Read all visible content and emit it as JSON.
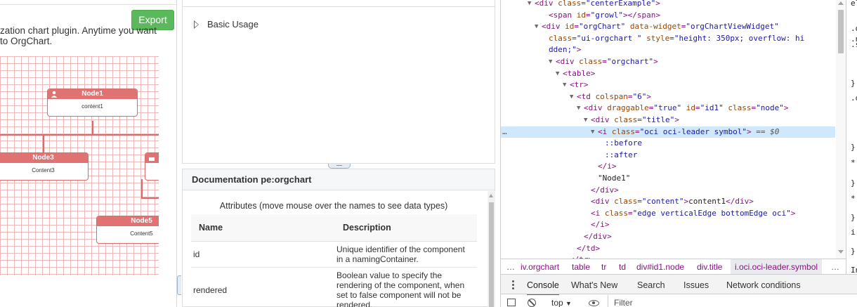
{
  "left": {
    "export_label": "Export",
    "intro_line1": "zation chart plugin. Anytime you want",
    "intro_line2": "to OrgChart.",
    "nodes": [
      {
        "title": "Node1",
        "content": "content1"
      },
      {
        "title": "Node3",
        "content": "Content3"
      },
      {
        "title": "Node5",
        "content": "Content5"
      }
    ]
  },
  "middle": {
    "basic_usage": "Basic Usage",
    "doc_title": "Documentation pe:orgchart",
    "attributes_caption": "Attributes (move mouse over the names to see data types)",
    "columns": [
      "Name",
      "Description"
    ],
    "rows": [
      {
        "name": "id",
        "desc": "Unique identifier of the component in a namingContainer."
      },
      {
        "name": "rendered",
        "desc": "Boolean value to specify the rendering of the component, when set to false component will not be rendered."
      }
    ]
  },
  "devtools": {
    "lines": [
      {
        "indent": 5,
        "arrow": "▼",
        "html": "<span class='tag'>&lt;div</span> <span class='an'>class</span><span class='tag'>=</span><span class='av'>\"centerExample\"</span><span class='tag'>&gt;</span>"
      },
      {
        "indent": 7,
        "arrow": "",
        "html": "<span class='tag'>&lt;span</span> <span class='an'>id</span><span class='tag'>=</span><span class='av'>\"growl\"</span><span class='tag'>&gt;&lt;/span&gt;</span>"
      },
      {
        "indent": 6,
        "arrow": "▼",
        "html": "<span class='tag'>&lt;div</span> <span class='an'>id</span><span class='tag'>=</span><span class='av'>\"orgChart\"</span> <span class='an'>data-widget</span><span class='tag'>=</span><span class='av'>\"orgChartViewWidget\"</span>"
      },
      {
        "indent": 7,
        "arrow": "",
        "html": "<span class='an'>class</span><span class='tag'>=</span><span class='av'>\"ui-orgchart \"</span> <span class='an'>style</span><span class='tag'>=</span><span class='av'>\"height: 350px; overflow: hi</span>"
      },
      {
        "indent": 7,
        "arrow": "",
        "html": "<span class='av'>dden;\"</span><span class='tag'>&gt;</span>"
      },
      {
        "indent": 8,
        "arrow": "▼",
        "html": "<span class='tag'>&lt;div</span> <span class='an'>class</span><span class='tag'>=</span><span class='av'>\"orgchart\"</span><span class='tag'>&gt;</span>"
      },
      {
        "indent": 9,
        "arrow": "▼",
        "html": "<span class='tag'>&lt;table&gt;</span>"
      },
      {
        "indent": 10,
        "arrow": "▼",
        "html": "<span class='tag'>&lt;tr&gt;</span>"
      },
      {
        "indent": 11,
        "arrow": "▼",
        "html": "<span class='tag'>&lt;td</span> <span class='an'>colspan</span><span class='tag'>=</span><span class='av'>\"6\"</span><span class='tag'>&gt;</span>"
      },
      {
        "indent": 12,
        "arrow": "▼",
        "html": "<span class='tag'>&lt;div</span> <span class='an'>draggable</span><span class='tag'>=</span><span class='av'>\"true\"</span> <span class='an'>id</span><span class='tag'>=</span><span class='av'>\"id1\"</span> <span class='an'>class</span><span class='tag'>=</span><span class='av'>\"node\"</span><span class='tag'>&gt;</span>"
      },
      {
        "indent": 13,
        "arrow": "▼",
        "html": "<span class='tag'>&lt;div</span> <span class='an'>class</span><span class='tag'>=</span><span class='av'>\"title\"</span><span class='tag'>&gt;</span>"
      },
      {
        "indent": 14,
        "arrow": "▼",
        "sel": true,
        "html": "<span class='tag'>&lt;i</span> <span class='an'>class</span><span class='tag'>=</span><span class='av'>\"oci oci-leader symbol\"</span><span class='tag'>&gt;</span> <span class='eq'>== $0</span>"
      },
      {
        "indent": 15,
        "arrow": "",
        "html": "<span class='ps'>::before</span>"
      },
      {
        "indent": 15,
        "arrow": "",
        "html": "<span class='ps'>::after</span>"
      },
      {
        "indent": 14,
        "arrow": "",
        "html": "<span class='tag'>&lt;/i&gt;</span>"
      },
      {
        "indent": 14,
        "arrow": "",
        "html": "<span class='tx'>\"Node1\"</span>"
      },
      {
        "indent": 13,
        "arrow": "",
        "html": "<span class='tag'>&lt;/div&gt;</span>"
      },
      {
        "indent": 13,
        "arrow": "",
        "html": "<span class='tag'>&lt;div</span> <span class='an'>class</span><span class='tag'>=</span><span class='av'>\"content\"</span><span class='tag'>&gt;</span><span class='tx'>content1</span><span class='tag'>&lt;/div&gt;</span>"
      },
      {
        "indent": 13,
        "arrow": "",
        "html": "<span class='tag'>&lt;i</span> <span class='an'>class</span><span class='tag'>=</span><span class='av'>\"edge verticalEdge bottomEdge oci\"</span><span class='tag'>&gt;</span>"
      },
      {
        "indent": 13,
        "arrow": "",
        "html": "<span class='tag'>&lt;/i&gt;</span>"
      },
      {
        "indent": 12,
        "arrow": "",
        "html": "<span class='tag'>&lt;/div&gt;</span>"
      },
      {
        "indent": 11,
        "arrow": "",
        "html": "<span class='tag'>&lt;/td&gt;</span>"
      },
      {
        "indent": 10,
        "arrow": "",
        "html": "<span class='tag'>&lt;/tr&gt;</span>"
      }
    ],
    "crumbs": [
      "…",
      "iv.orgchart",
      "table",
      "tr",
      "td",
      "div#id1.node",
      "div.title",
      "i.oci.oci-leader.symbol",
      "…"
    ],
    "drawer_tabs": [
      "Console",
      "What's New",
      "Search",
      "Issues",
      "Network conditions"
    ],
    "context": "top",
    "filter_placeholder": "Filter",
    "styles_gutter": [
      "el",
      ".o",
      ".n",
      ".s",
      "}",
      ".o",
      "}",
      "*",
      "}",
      "*",
      "}",
      "i",
      "}",
      "In"
    ]
  }
}
